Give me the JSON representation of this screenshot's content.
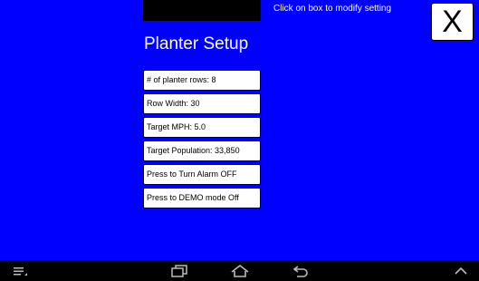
{
  "header": {
    "hint": "Click on box to modify setting",
    "close_label": "X"
  },
  "page": {
    "title": "Planter Setup"
  },
  "settings": [
    {
      "label": "# of planter rows: 8"
    },
    {
      "label": "Row Width: 30"
    },
    {
      "label": "Target MPH: 5.0"
    },
    {
      "label": "Target Population: 33,850"
    },
    {
      "label": "Press to Turn Alarm OFF"
    },
    {
      "label": "Press to DEMO mode Off"
    }
  ],
  "navbar": {
    "icons": [
      "menu-icon",
      "recent-apps-icon",
      "home-icon",
      "back-icon",
      "chevron-up-icon"
    ]
  },
  "colors": {
    "background": "#0000ff",
    "button": "#ffffff",
    "navbar": "#000000"
  }
}
